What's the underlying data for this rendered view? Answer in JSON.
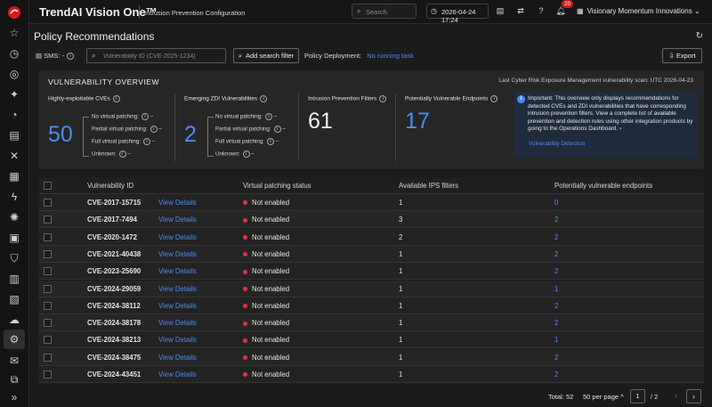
{
  "header": {
    "brand": "TrendAI Vision One™",
    "app_name": "Intrusion Prevention Configuration",
    "search_placeholder": "Search",
    "datetime": "2026-04-24 17:24",
    "notification_count": "20",
    "org_name": "Visionary Momentum Innovations"
  },
  "page": {
    "title": "Policy Recommendations"
  },
  "toolbar": {
    "sms_label": "SMS: -",
    "search_placeholder": "Vulnerability ID (CVE-2025-1234)",
    "add_filter_label": "Add search filter",
    "deployment_label": "Policy Deployment:",
    "deployment_status": "No running task",
    "export_label": "Export"
  },
  "overview": {
    "title": "VULNERABILITY OVERVIEW",
    "last_scan": "Last Cyber Risk Exposure Management vulnerability scan: UTC  2026-04-23",
    "highly_exploitable": {
      "label": "Highly-exploitable CVEs",
      "value": "50",
      "no_vp": "No virtual patching:",
      "no_vp_val": "–",
      "partial_vp": "Partial virtual patching:",
      "partial_vp_val": "–",
      "full_vp": "Full virtual patching:",
      "full_vp_val": "–",
      "unknown": "Unknown:",
      "unknown_val": "–"
    },
    "emerging_zdi": {
      "label": "Emerging ZDI Vulnerabilities",
      "value": "2",
      "no_vp": "No virtual patching:",
      "no_vp_val": "–",
      "partial_vp": "Partial virtual patching:",
      "partial_vp_val": "–",
      "full_vp": "Full virtual patching:",
      "full_vp_val": "–",
      "unknown": "Unknown:",
      "unknown_val": "–"
    },
    "ips_filters": {
      "label": "Intrusion Prevention Filters",
      "value": "61"
    },
    "vulnerable_endpoints": {
      "label": "Potentially Vulnerable Endpoints",
      "value": "17"
    },
    "note": "Important: This overview only displays recommendations for detected CVEs and ZDI vulnerabilities that have corresponding intrusion prevention filters. View a complete list of available prevention and detection rules using other integration products by going to the Operations Dashboard. ›",
    "note_link": "Vulnerability Detection"
  },
  "table": {
    "columns": [
      "Vulnerability ID",
      "Virtual patching status",
      "Available IPS filters",
      "Potentially vulnerable endpoints"
    ],
    "view_label": "View Details",
    "rows": [
      {
        "id": "CVE-2017-15715",
        "status": "Not enabled",
        "filters": "1",
        "endpoints": "0"
      },
      {
        "id": "CVE-2017-7494",
        "status": "Not enabled",
        "filters": "3",
        "endpoints": "2"
      },
      {
        "id": "CVE-2020-1472",
        "status": "Not enabled",
        "filters": "2",
        "endpoints": "2"
      },
      {
        "id": "CVE-2021-40438",
        "status": "Not enabled",
        "filters": "1",
        "endpoints": "2"
      },
      {
        "id": "CVE-2023-25690",
        "status": "Not enabled",
        "filters": "1",
        "endpoints": "2"
      },
      {
        "id": "CVE-2024-29059",
        "status": "Not enabled",
        "filters": "1",
        "endpoints": "1"
      },
      {
        "id": "CVE-2024-38112",
        "status": "Not enabled",
        "filters": "1",
        "endpoints": "2"
      },
      {
        "id": "CVE-2024-38178",
        "status": "Not enabled",
        "filters": "1",
        "endpoints": "2"
      },
      {
        "id": "CVE-2024-38213",
        "status": "Not enabled",
        "filters": "1",
        "endpoints": "1"
      },
      {
        "id": "CVE-2024-38475",
        "status": "Not enabled",
        "filters": "1",
        "endpoints": "2"
      },
      {
        "id": "CVE-2024-43451",
        "status": "Not enabled",
        "filters": "1",
        "endpoints": "2"
      }
    ]
  },
  "pagination": {
    "total": "Total: 52",
    "per_page": "50 per page ^",
    "current_page": "1",
    "of_pages": "/   2",
    "prev": "‹",
    "next": "›"
  },
  "colors": {
    "accent": "#4d8cf5",
    "status_red": "#e1333b",
    "brand_red": "#d71920"
  }
}
